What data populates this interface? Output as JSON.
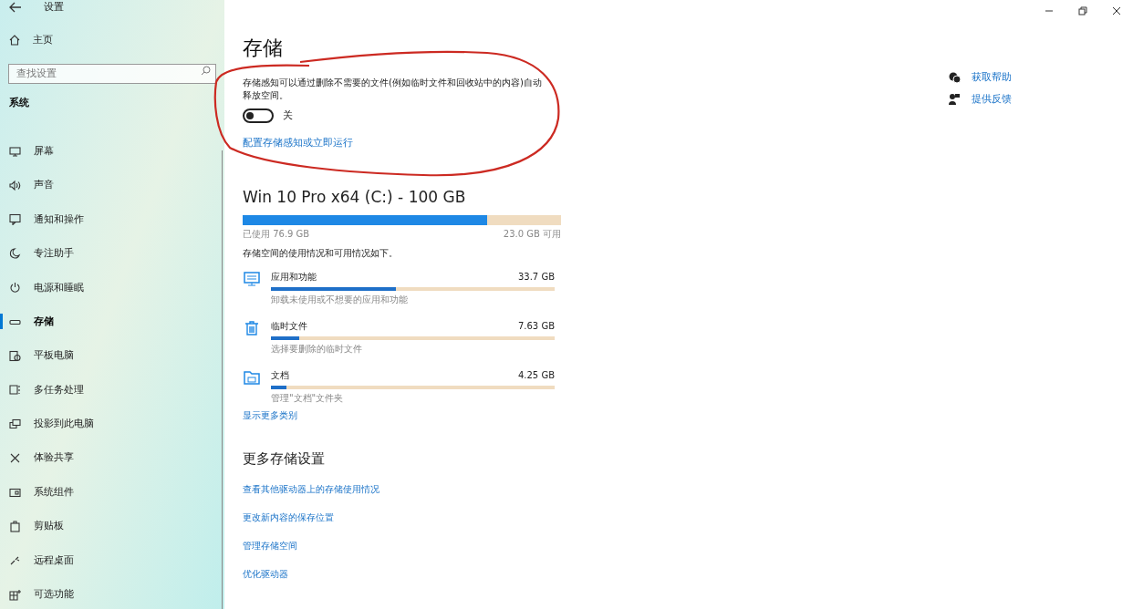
{
  "window": {
    "title": "设置"
  },
  "sidebar": {
    "home": "主页",
    "search": {
      "placeholder": "查找设置"
    },
    "section": "系统",
    "items": [
      {
        "label": "屏幕",
        "selected": false
      },
      {
        "label": "声音",
        "selected": false
      },
      {
        "label": "通知和操作",
        "selected": false
      },
      {
        "label": "专注助手",
        "selected": false
      },
      {
        "label": "电源和睡眠",
        "selected": false
      },
      {
        "label": "存储",
        "selected": true
      },
      {
        "label": "平板电脑",
        "selected": false
      },
      {
        "label": "多任务处理",
        "selected": false
      },
      {
        "label": "投影到此电脑",
        "selected": false
      },
      {
        "label": "体验共享",
        "selected": false
      },
      {
        "label": "系统组件",
        "selected": false
      },
      {
        "label": "剪贴板",
        "selected": false
      },
      {
        "label": "远程桌面",
        "selected": false
      },
      {
        "label": "可选功能",
        "selected": false
      }
    ]
  },
  "page": {
    "title": "存储",
    "description": "存储感知可以通过删除不需要的文件(例如临时文件和回收站中的内容)自动释放空间。",
    "toggle": {
      "on": false,
      "label": "关"
    },
    "configure_link": "配置存储感知或立即运行",
    "drive": {
      "title": "Win 10 Pro x64 (C:) - 100 GB",
      "level": 0.769,
      "used": "已使用 76.9 GB",
      "free": "23.0 GB 可用"
    },
    "usage_note": "存储空间的使用情况和可用情况如下。",
    "categories": [
      {
        "name": "应用和功能",
        "size": "33.7 GB",
        "level": 0.44,
        "hint": "卸载未使用或不想要的应用和功能"
      },
      {
        "name": "临时文件",
        "size": "7.63 GB",
        "level": 0.1,
        "hint": "选择要删除的临时文件"
      },
      {
        "name": "文档",
        "size": "4.25 GB",
        "level": 0.055,
        "hint": "管理\"文档\"文件夹"
      }
    ],
    "more_categories": "显示更多类别",
    "more_title": "更多存储设置",
    "more_links": [
      "查看其他驱动器上的存储使用情况",
      "更改新内容的保存位置",
      "管理存储空间",
      "优化驱动器"
    ]
  },
  "help": [
    "获取帮助",
    "提供反馈"
  ],
  "markup": [
    {
      "kind": "ellipse",
      "color": "#cc2a22"
    }
  ]
}
